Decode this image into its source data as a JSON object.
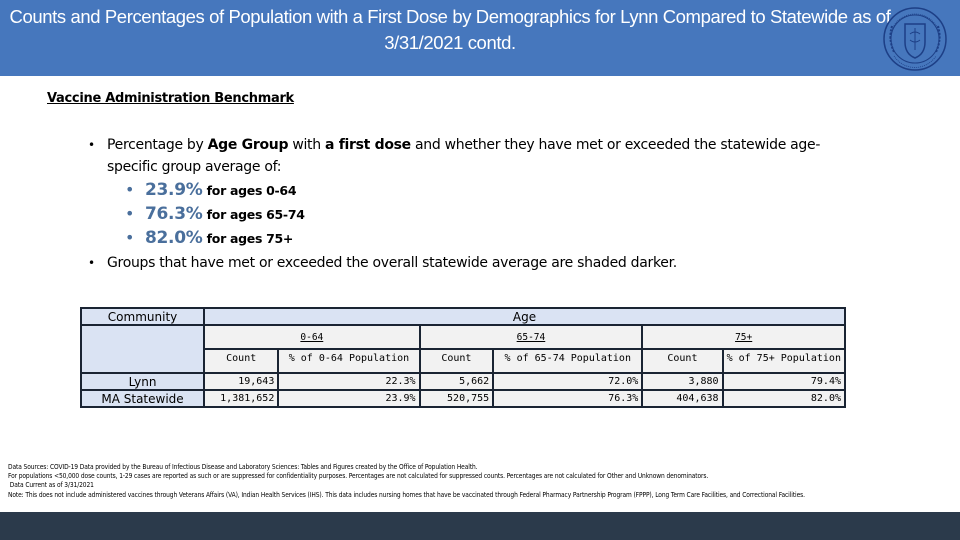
{
  "header": {
    "title": "Counts and Percentages of Population with a First Dose by Demographics for Lynn Compared to Statewide as of 3/31/2021  contd.",
    "logo": "state-seal-icon"
  },
  "section": {
    "heading": "Vaccine Administration Benchmark"
  },
  "bullets": {
    "first": {
      "pre": "Percentage by ",
      "bold1": "Age Group",
      "mid": " with ",
      "bold2": "a first dose",
      "post": " and whether they have met or exceeded the statewide age-specific group average of:"
    },
    "benchmarks": [
      {
        "percent": "23.9%",
        "label": "for ages 0-64"
      },
      {
        "percent": "76.3%",
        "label": "for ages 65-74"
      },
      {
        "percent": "82.0%",
        "label": "for ages 75+"
      }
    ],
    "second": "Groups that have met or exceeded the overall statewide average are shaded darker."
  },
  "table": {
    "community_header": "Community",
    "age_header": "Age",
    "groups": [
      "0-64",
      "65-74",
      "75+"
    ],
    "columns": [
      "Count",
      "% of 0-64 Population",
      "Count",
      "% of 65-74 Population",
      "Count",
      "% of 75+ Population"
    ],
    "rows": [
      {
        "community": "Lynn",
        "values": [
          "19,643",
          "22.3%",
          "5,662",
          "72.0%",
          "3,880",
          "79.4%"
        ]
      },
      {
        "community": "MA Statewide",
        "values": [
          "1,381,652",
          "23.9%",
          "520,755",
          "76.3%",
          "404,638",
          "82.0%"
        ]
      }
    ]
  },
  "notes": [
    "Data Sources: COVID-19 Data provided by the Bureau of Infectious Disease and Laboratory Sciences: Tables and Figures created by the Office of Population Health.",
    "For populations <50,000 dose counts, 1-29 cases are reported as such or are suppressed for confidentiality purposes. Percentages are not calculated for suppressed counts. Percentages are not calculated for Other and Unknown denominators.",
    " Data Current as of 3/31/2021",
    "Note: This does not include administered vaccines through Veterans Affairs (VA), Indian Health Services (IHS). This data includes nursing homes that have be vaccinated through Federal Pharmacy Partnership Program (FPPP), Long Term Care Facilities, and Correctional Facilities."
  ],
  "colors": {
    "header_bg": "#4677bd",
    "benchmark_text": "#4a6f9c",
    "table_header_bg": "#dae3f3",
    "table_cell_bg": "#f2f2f2",
    "footer_bg": "#2b3a4b"
  }
}
